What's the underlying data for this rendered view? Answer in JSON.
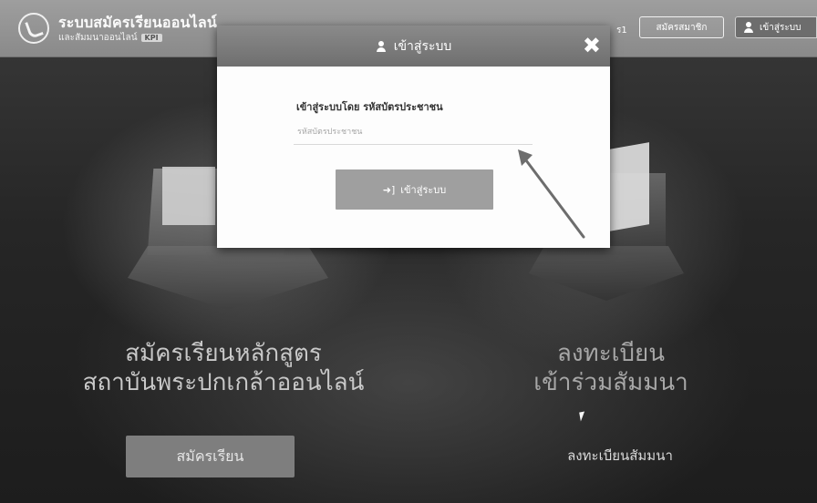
{
  "header": {
    "title": "ระบบสมัครเรียนออนไลน์",
    "subtitle": "และสัมมนาออนไลน์",
    "subtitle_tag": "KPI",
    "nav_partial": "ร1",
    "register_label": "สมัครสมาชิก",
    "login_label": "เข้าสู่ระบบ"
  },
  "modal": {
    "title": "เข้าสู่ระบบ",
    "close_symbol": "✖",
    "form_label": "เข้าสู่ระบบโดย รหัสบัตรประชาชน",
    "id_placeholder": "รหัสบัตรประชาชน",
    "id_value": "",
    "submit_label": "เข้าสู่ระบบ",
    "submit_icon": "➜]"
  },
  "sections": {
    "left_heading_line1": "สมัครเรียนหลักสูตร",
    "left_heading_line2": "สถาบันพระปกเกล้าออนไลน์",
    "apply_button": "สมัครเรียน",
    "right_heading_line1": "ลงทะเบียน",
    "right_heading_line2": "เข้าร่วมสัมมนา",
    "seminar_link": "ลงทะเบียนสัมมนา"
  },
  "colors": {
    "header_bg": "#8f8f8f",
    "modal_header_bg": "#7c7c7c",
    "submit_bg": "#9f9f9f",
    "annotation_arrow": "#6d6d6d"
  },
  "icons": {
    "logo": "hand-circle-logo-icon",
    "user": "user-icon",
    "close": "close-icon",
    "submit": "login-arrow-icon",
    "cursor": "mouse-cursor-icon",
    "annotation": "annotation-arrow-icon"
  }
}
